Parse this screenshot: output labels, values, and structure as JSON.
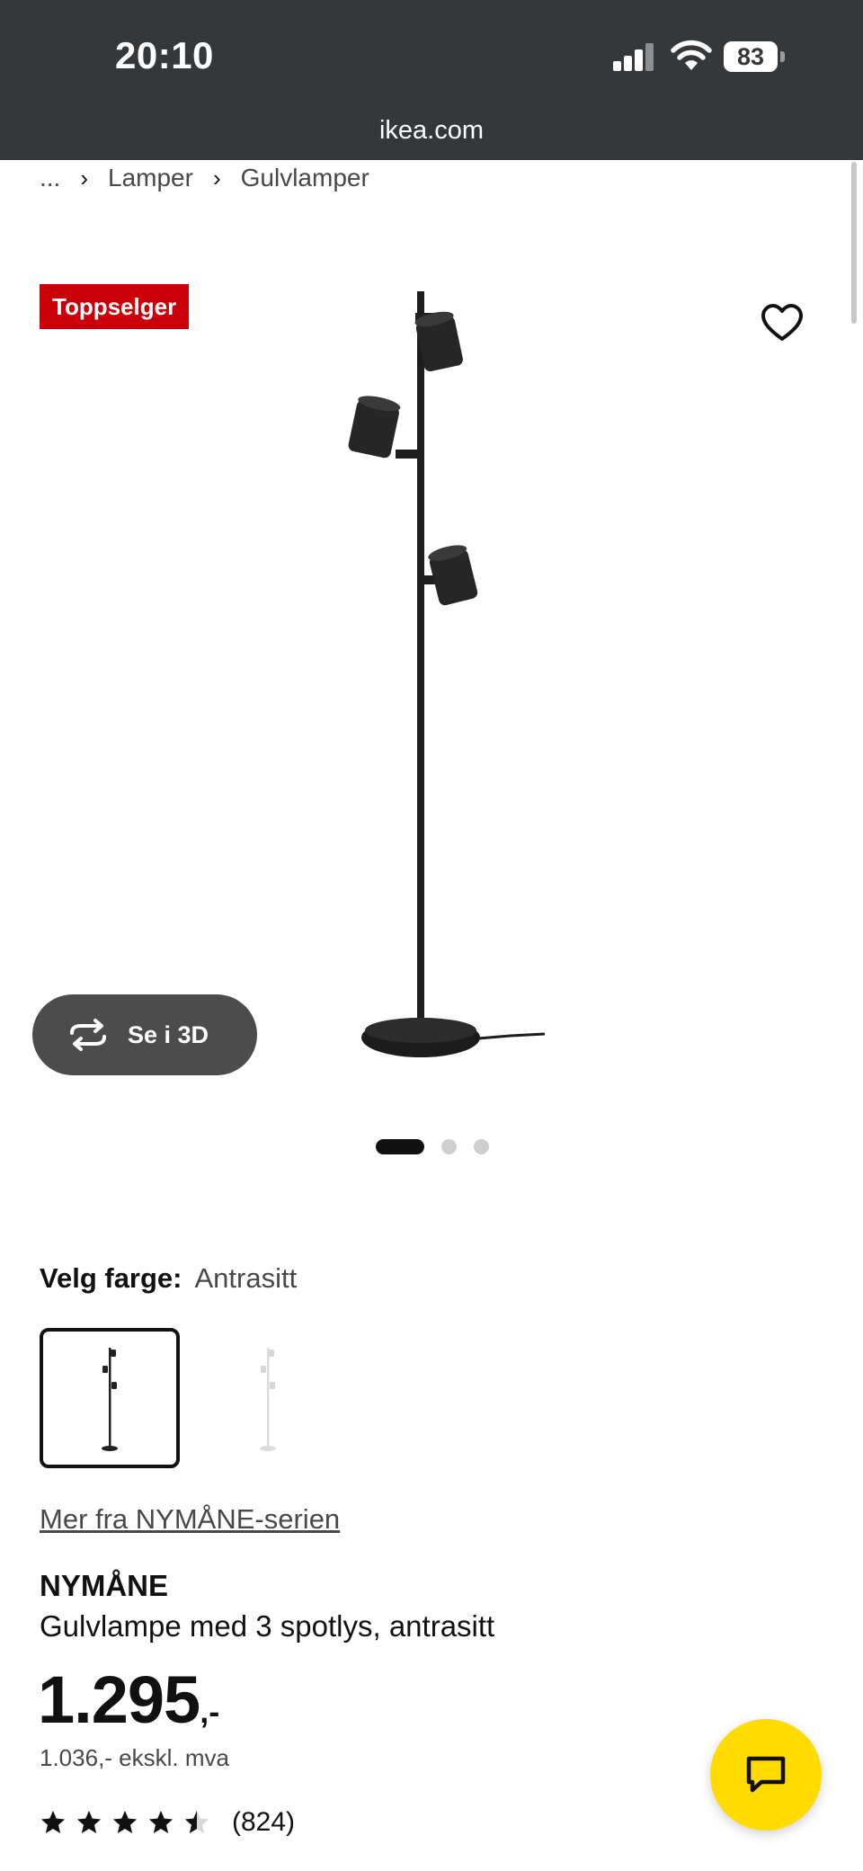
{
  "status_bar": {
    "time": "20:10",
    "battery": "83"
  },
  "browser": {
    "url": "ikea.com"
  },
  "breadcrumb": [
    "...",
    "Lamper",
    "Gulvlamper"
  ],
  "badge": "Toppselger",
  "view3d": {
    "label": "Se i 3D"
  },
  "carousel": {
    "count": 3,
    "active_index": 0
  },
  "color": {
    "label": "Velg farge:",
    "value": "Antrasitt"
  },
  "swatches": [
    {
      "name": "Antrasitt",
      "selected": true
    },
    {
      "name": "Hvit",
      "selected": false
    }
  ],
  "series_link": "Mer fra NYMÅNE-serien",
  "product": {
    "name": "NYMÅNE",
    "description": "Gulvlampe med 3 spotlys, antrasitt",
    "price_main": "1.295",
    "price_suffix": ",-",
    "price_ex_vat": "1.036,- ekskl. mva"
  },
  "rating": {
    "value": 4.5,
    "max": 5,
    "count": "(824)"
  },
  "colors": {
    "status_bar_bg": "#35383b",
    "badge_bg": "#cc0008",
    "fab_bg": "#ffdb00",
    "text": "#111111",
    "text_muted": "#484848"
  },
  "icons": [
    "signal-icon",
    "wifi-icon",
    "battery-icon",
    "heart-icon",
    "rotate-icon",
    "star-icon",
    "chat-icon"
  ]
}
